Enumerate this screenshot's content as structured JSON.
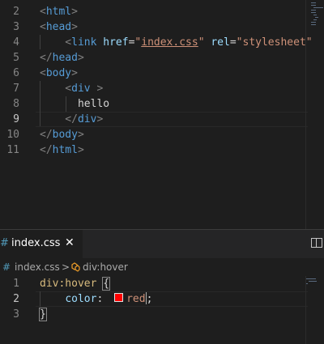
{
  "top_editor": {
    "lines": [
      {
        "num": "2",
        "parts": [
          {
            "t": "<",
            "c": "tk-punct"
          },
          {
            "t": "html",
            "c": "tk-tag"
          },
          {
            "t": ">",
            "c": "tk-punct"
          }
        ]
      },
      {
        "num": "3",
        "parts": [
          {
            "t": "<",
            "c": "tk-punct"
          },
          {
            "t": "head",
            "c": "tk-tag"
          },
          {
            "t": ">",
            "c": "tk-punct"
          }
        ]
      },
      {
        "num": "4",
        "parts": [
          {
            "t": "    <",
            "c": "tk-punct"
          },
          {
            "t": "link",
            "c": "tk-tag"
          },
          {
            "t": " ",
            "c": "tk-text"
          },
          {
            "t": "href",
            "c": "tk-attr"
          },
          {
            "t": "=",
            "c": "tk-text"
          },
          {
            "t": "\"",
            "c": "tk-str"
          },
          {
            "t": "index.css",
            "c": "tk-str link-underline"
          },
          {
            "t": "\"",
            "c": "tk-str"
          },
          {
            "t": " ",
            "c": "tk-text"
          },
          {
            "t": "rel",
            "c": "tk-attr"
          },
          {
            "t": "=",
            "c": "tk-text"
          },
          {
            "t": "\"stylesheet\"",
            "c": "tk-str"
          }
        ]
      },
      {
        "num": "5",
        "parts": [
          {
            "t": "</",
            "c": "tk-punct"
          },
          {
            "t": "head",
            "c": "tk-tag"
          },
          {
            "t": ">",
            "c": "tk-punct"
          }
        ]
      },
      {
        "num": "6",
        "parts": [
          {
            "t": "<",
            "c": "tk-punct"
          },
          {
            "t": "body",
            "c": "tk-tag"
          },
          {
            "t": ">",
            "c": "tk-punct"
          }
        ]
      },
      {
        "num": "7",
        "parts": [
          {
            "t": "    <",
            "c": "tk-punct"
          },
          {
            "t": "div",
            "c": "tk-tag"
          },
          {
            "t": " >",
            "c": "tk-punct"
          }
        ]
      },
      {
        "num": "8",
        "parts": [
          {
            "t": "      hello",
            "c": "tk-text"
          }
        ]
      },
      {
        "num": "9",
        "parts": [
          {
            "t": "    </",
            "c": "tk-punct"
          },
          {
            "t": "div",
            "c": "tk-tag"
          },
          {
            "t": ">",
            "c": "tk-punct"
          }
        ],
        "current": true
      },
      {
        "num": "10",
        "parts": [
          {
            "t": "</",
            "c": "tk-punct"
          },
          {
            "t": "body",
            "c": "tk-tag"
          },
          {
            "t": ">",
            "c": "tk-punct"
          }
        ]
      },
      {
        "num": "11",
        "parts": [
          {
            "t": "</",
            "c": "tk-punct"
          },
          {
            "t": "html",
            "c": "tk-tag"
          },
          {
            "t": ">",
            "c": "tk-punct"
          }
        ]
      }
    ]
  },
  "tab": {
    "icon": "css-hash-icon",
    "hash": "#",
    "label": "index.css",
    "close_glyph": "✕"
  },
  "breadcrumb": {
    "hash": "#",
    "file": "index.css",
    "separator": ">",
    "symbol": "div:hover"
  },
  "bottom_editor": {
    "lines": [
      {
        "num": "1",
        "parts": [
          {
            "t": "div:hover",
            "c": "tk-sel"
          },
          {
            "t": " ",
            "c": "tk-text"
          },
          {
            "t": "{",
            "c": "tk-text bracket-match"
          }
        ]
      },
      {
        "num": "2",
        "parts": [
          {
            "t": "    ",
            "c": "tk-text"
          },
          {
            "t": "color",
            "c": "tk-prop"
          },
          {
            "t": ": ",
            "c": "tk-text"
          },
          {
            "t": "SWATCH",
            "c": "swatch"
          },
          {
            "t": "red",
            "c": "tk-val"
          },
          {
            "t": "CURSOR",
            "c": "cursor"
          },
          {
            "t": ";",
            "c": "tk-text"
          }
        ],
        "current": true
      },
      {
        "num": "3",
        "parts": [
          {
            "t": "}",
            "c": "tk-text bracket-match"
          }
        ]
      }
    ]
  },
  "colors": {
    "background": "#1e1e1e",
    "swatch": "#ff0000"
  }
}
